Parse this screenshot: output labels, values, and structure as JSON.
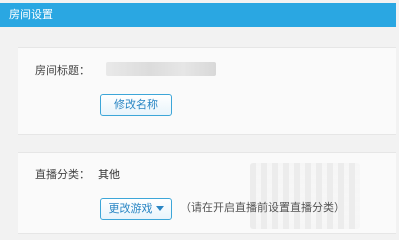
{
  "header": {
    "title": "房间设置"
  },
  "room_title": {
    "label": "房间标题：",
    "rename_button": "修改名称"
  },
  "category": {
    "label": "直播分类：",
    "value": "其他",
    "change_button": "更改游戏",
    "hint": "（请在开启直播前设置直播分类）"
  },
  "colors": {
    "header_bg": "#2aa7e2",
    "button_border": "#3da6d8",
    "button_text": "#2a86c4"
  },
  "icons": {
    "change_button_caret": "caret-down-icon"
  }
}
